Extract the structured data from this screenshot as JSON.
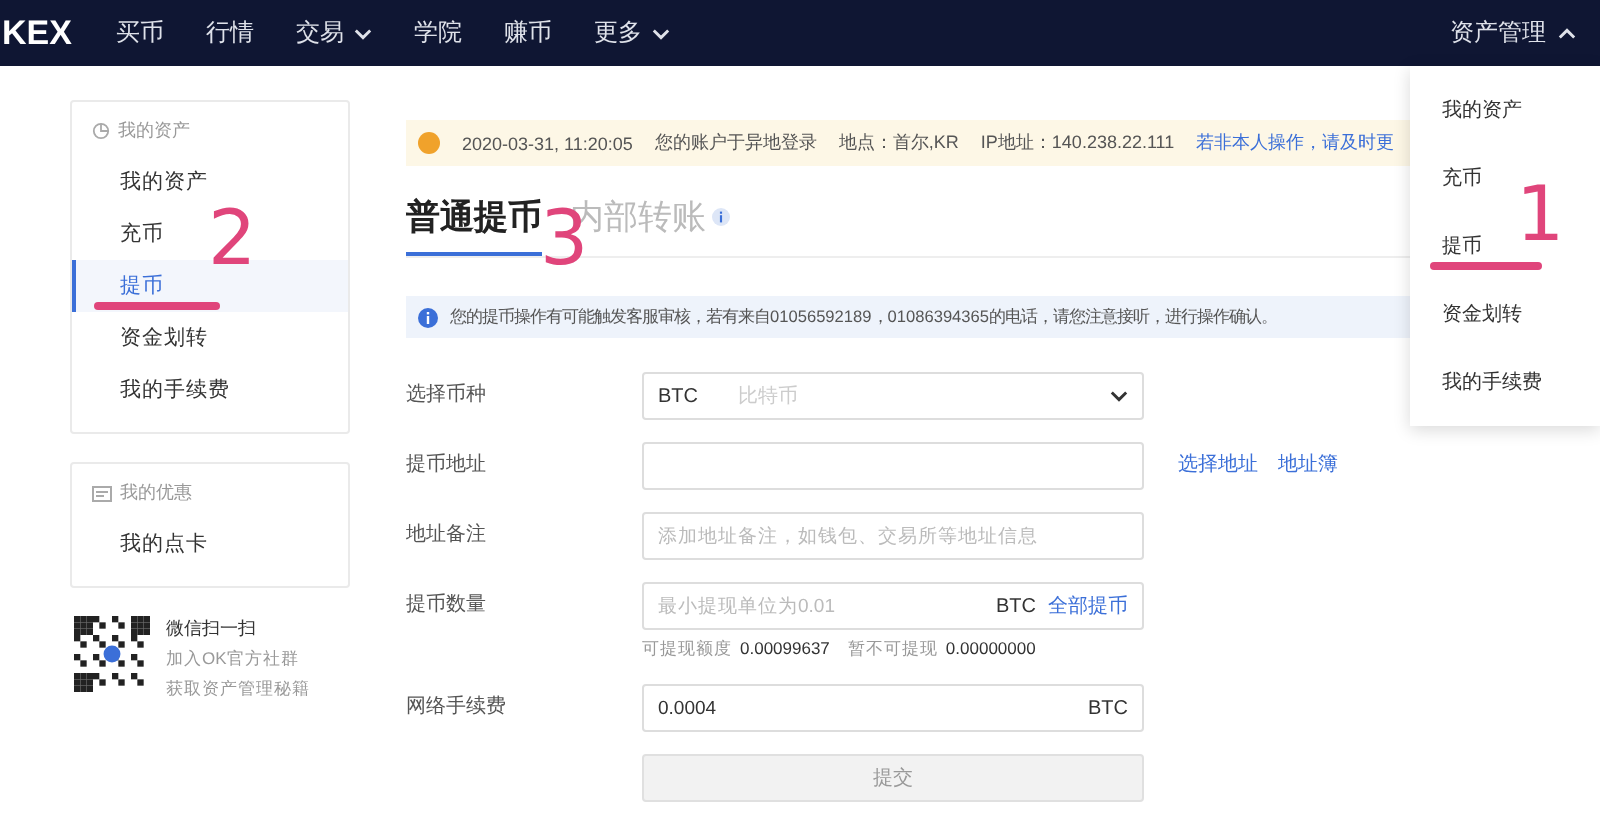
{
  "nav": {
    "logo": "KEX",
    "items": [
      {
        "label": "买币",
        "caret": false
      },
      {
        "label": "行情",
        "caret": false
      },
      {
        "label": "交易",
        "caret": true
      },
      {
        "label": "学院",
        "caret": false
      },
      {
        "label": "赚币",
        "caret": false
      },
      {
        "label": "更多",
        "caret": true
      }
    ],
    "account_menu": {
      "label": "资产管理",
      "expanded": true
    }
  },
  "dropdown": {
    "items": [
      {
        "label": "我的资产"
      },
      {
        "label": "充币"
      },
      {
        "label": "提币"
      },
      {
        "label": "资金划转"
      },
      {
        "label": "我的手续费"
      }
    ]
  },
  "sidebar": {
    "groups": [
      {
        "title": "我的资产",
        "items": [
          {
            "label": "我的资产",
            "selected": false
          },
          {
            "label": "充币",
            "selected": false
          },
          {
            "label": "提币",
            "selected": true
          },
          {
            "label": "资金划转",
            "selected": false
          },
          {
            "label": "我的手续费",
            "selected": false
          }
        ]
      },
      {
        "title": "我的优惠",
        "items": [
          {
            "label": "我的点卡",
            "selected": false
          }
        ]
      }
    ],
    "promo": {
      "title": "微信扫一扫",
      "lines": [
        "加入OK官方社群",
        "获取资产管理秘籍"
      ]
    }
  },
  "alert": {
    "time": "2020-03-31, 11:20:05",
    "message": "您的账户于异地登录",
    "location": "地点：首尔,KR",
    "ip": "IP地址：140.238.22.111",
    "link": "若非本人操作，请及时更"
  },
  "tabs": [
    {
      "label": "普通提币",
      "selected": true
    },
    {
      "label": "内部转账",
      "selected": false
    }
  ],
  "notice": "您的提币操作有可能触发客服审核，若有来自01056592189，01086394365的电话，请您注意接听，进行操作确认。",
  "form": {
    "rows": [
      {
        "kind": "select",
        "label": "选择币种",
        "value": "BTC",
        "hint": "比特币"
      },
      {
        "kind": "address",
        "label": "提币地址",
        "links": [
          "选择地址",
          "地址簿"
        ]
      },
      {
        "kind": "text",
        "label": "地址备注",
        "placeholder": "添加地址备注，如钱包、交易所等地址信息"
      },
      {
        "kind": "amount",
        "label": "提币数量",
        "placeholder": "最小提现单位为0.01",
        "unit": "BTC",
        "action": "全部提币",
        "balances": [
          {
            "label": "可提现额度",
            "value": "0.00099637"
          },
          {
            "label": "暂不可提现",
            "value": "0.00000000"
          }
        ]
      },
      {
        "kind": "fee",
        "label": "网络手续费",
        "value": "0.0004",
        "unit": "BTC"
      }
    ],
    "submit": "提交"
  },
  "annotations": [
    {
      "label": "1"
    },
    {
      "label": "2"
    },
    {
      "label": "3"
    }
  ]
}
